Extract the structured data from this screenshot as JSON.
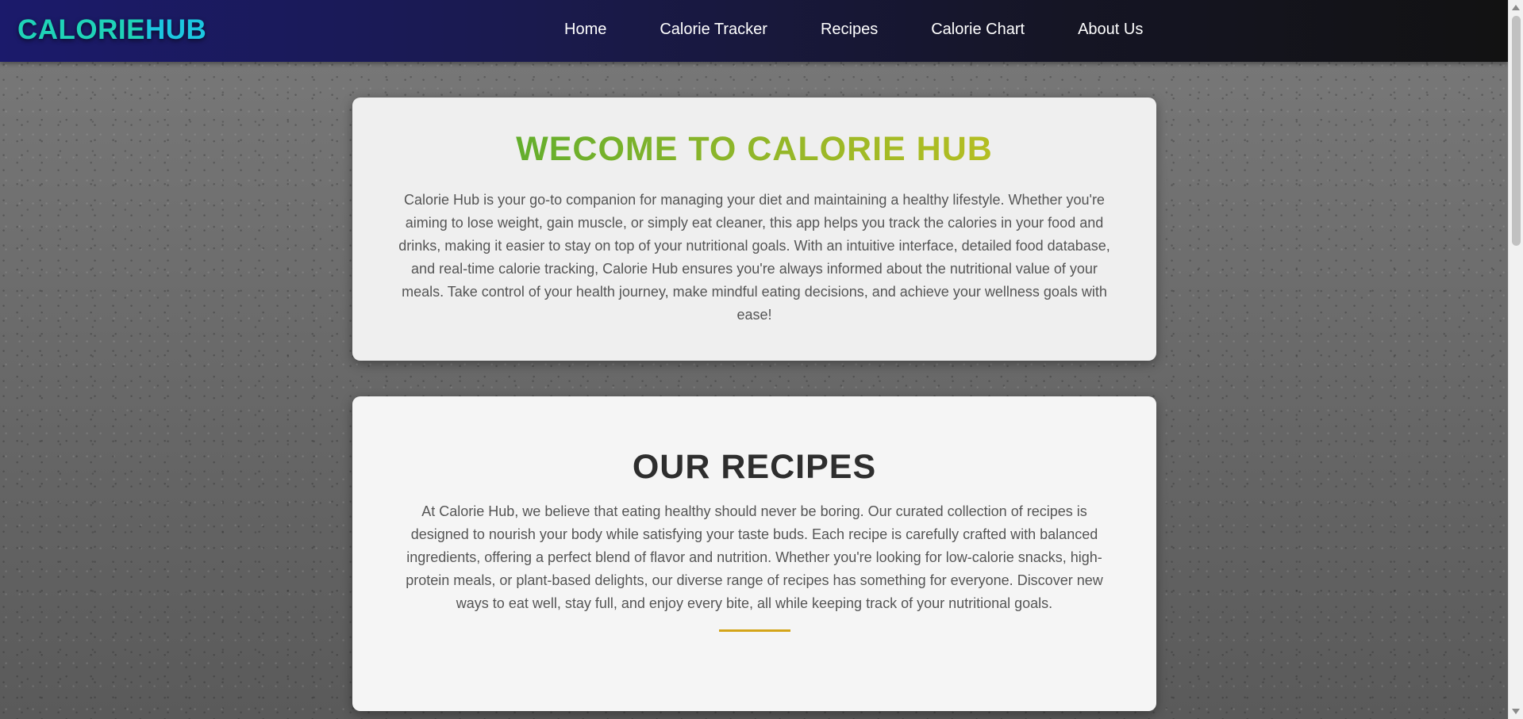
{
  "header": {
    "logo_part1": "CALORIE",
    "logo_part2": "HUB",
    "nav": [
      {
        "label": "Home"
      },
      {
        "label": "Calorie Tracker"
      },
      {
        "label": "Recipes"
      },
      {
        "label": "Calorie Chart"
      },
      {
        "label": "About Us"
      }
    ]
  },
  "welcome": {
    "title": "WECOME TO CALORIE HUB",
    "body": "Calorie Hub is your go-to companion for managing your diet and maintaining a healthy lifestyle. Whether you're aiming to lose weight, gain muscle, or simply eat cleaner, this app helps you track the calories in your food and drinks, making it easier to stay on top of your nutritional goals. With an intuitive interface, detailed food database, and real-time calorie tracking, Calorie Hub ensures you're always informed about the nutritional value of your meals. Take control of your health journey, make mindful eating decisions, and achieve your wellness goals with ease!"
  },
  "recipes": {
    "title": "OUR RECIPES",
    "body": "At Calorie Hub, we believe that eating healthy should never be boring. Our curated collection of recipes is designed to nourish your body while satisfying your taste buds. Each recipe is carefully crafted with balanced ingredients, offering a perfect blend of flavor and nutrition. Whether you're looking for low-calorie snacks, high-protein meals, or plant-based delights, our diverse range of recipes has something for everyone. Discover new ways to eat well, stay full, and enjoy every bite, all while keeping track of your nutritional goals."
  },
  "colors": {
    "logo_part1": "#1fd3b8",
    "logo_part2": "#1cc7e0",
    "welcome_gradient_start": "#4caa2e",
    "welcome_gradient_end": "#c6c21f",
    "divider": "#d4a519"
  }
}
